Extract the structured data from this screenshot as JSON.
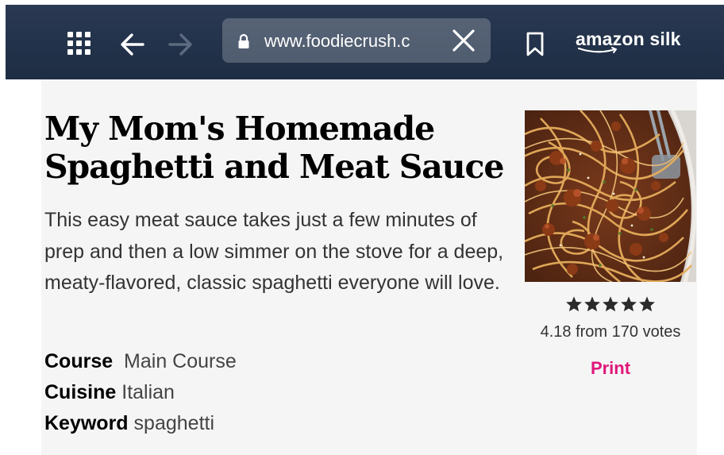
{
  "browser": {
    "url": "www.foodiecrush.c",
    "brand": "amazon silk",
    "icons": {
      "apps": "apps-grid-icon",
      "back": "back-arrow-icon",
      "forward": "forward-arrow-icon",
      "lock": "lock-icon",
      "clear": "close-icon",
      "bookmark": "bookmark-icon"
    },
    "forward_enabled": false
  },
  "recipe": {
    "title": "My Mom's Homemade Spaghetti and Meat Sauce",
    "summary": "This easy meat sauce takes just a few minutes of prep and then a low simmer on the stove for a deep, meaty-flavored, classic spaghetti everyone will love.",
    "meta": [
      {
        "key": "Course",
        "value": "Main Course"
      },
      {
        "key": "Cuisine",
        "value": "Italian"
      },
      {
        "key": "Keyword",
        "value": "spaghetti"
      }
    ],
    "rating": {
      "stars_filled": 5,
      "stars_total": 5,
      "text": "4.18 from 170 votes"
    },
    "print_label": "Print"
  },
  "colors": {
    "toolbar": "#22324a",
    "card_background": "#f5f5f5",
    "print_link": "#e0167a",
    "star": "#2b2b2b"
  }
}
